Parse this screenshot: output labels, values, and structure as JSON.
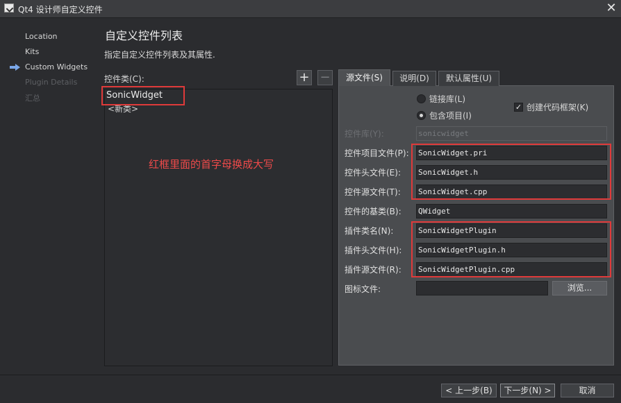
{
  "window": {
    "title": "Qt4 设计师自定义控件",
    "close_glyph": "✕"
  },
  "steps": [
    {
      "label": "Location",
      "state": "done"
    },
    {
      "label": "Kits",
      "state": "done"
    },
    {
      "label": "Custom Widgets",
      "state": "current"
    },
    {
      "label": "Plugin Details",
      "state": "disabled"
    },
    {
      "label": "汇总",
      "state": "disabled"
    }
  ],
  "header": {
    "title": "自定义控件列表",
    "subtitle": "指定自定义控件列表及其属性."
  },
  "class_list": {
    "label": "控件类(C):",
    "add_glyph": "+",
    "remove_glyph": "−",
    "items": [
      "SonicWidget",
      "<新类>"
    ]
  },
  "annotation": {
    "text": "红框里面的首字母换成大写",
    "color": "#e03a3a"
  },
  "tabs": [
    {
      "label": "源文件(S)",
      "active": true
    },
    {
      "label": "说明(D)",
      "active": false
    },
    {
      "label": "默认属性(U)",
      "active": false
    }
  ],
  "source_tab": {
    "radio_library": {
      "label": "链接库(L)",
      "checked": false
    },
    "radio_include": {
      "label": "包含项目(I)",
      "checked": true
    },
    "checkbox_skeleton": {
      "label": "创建代码框架(K)",
      "checked": true,
      "glyph": "✓"
    },
    "fields": [
      {
        "label": "控件库(Y):",
        "value": "sonicwidget",
        "enabled": false
      },
      {
        "label": "控件项目文件(P):",
        "value": "SonicWidget.pri",
        "enabled": true
      },
      {
        "label": "控件头文件(E):",
        "value": "SonicWidget.h",
        "enabled": true
      },
      {
        "label": "控件源文件(T):",
        "value": "SonicWidget.cpp",
        "enabled": true
      },
      {
        "label": "控件的基类(B):",
        "value": "QWidget",
        "enabled": true
      },
      {
        "label": "插件类名(N):",
        "value": "SonicWidgetPlugin",
        "enabled": true
      },
      {
        "label": "插件头文件(H):",
        "value": "SonicWidgetPlugin.h",
        "enabled": true
      },
      {
        "label": "插件源文件(R):",
        "value": "SonicWidgetPlugin.cpp",
        "enabled": true
      },
      {
        "label": "图标文件:",
        "value": "",
        "enabled": true
      }
    ],
    "browse_label": "浏览..."
  },
  "buttons": {
    "back": "< 上一步(B)",
    "next": "下一步(N) >",
    "cancel": "取消"
  },
  "colors": {
    "background": "#2b2c2f",
    "panel": "#4a4c4f",
    "annotation": "#e03a3a",
    "current_step_arrow": "#7aa7e8"
  }
}
